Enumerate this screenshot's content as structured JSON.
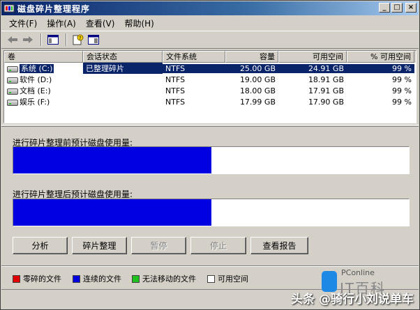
{
  "window": {
    "title": "磁盘碎片整理程序"
  },
  "menu": [
    "文件(F)",
    "操作(A)",
    "查看(V)",
    "帮助(H)"
  ],
  "list": {
    "columns": [
      "卷",
      "会话状态",
      "文件系统",
      "容量",
      "可用空间",
      "% 可用空间"
    ],
    "rows": [
      {
        "volume": "系统 (C:)",
        "status": "已整理碎片",
        "fs": "NTFS",
        "capacity": "25.00 GB",
        "free": "24.91 GB",
        "pct": "99 %",
        "selected": true
      },
      {
        "volume": "软件 (D:)",
        "status": "",
        "fs": "NTFS",
        "capacity": "19.00 GB",
        "free": "18.91 GB",
        "pct": "99 %"
      },
      {
        "volume": "文档 (E:)",
        "status": "",
        "fs": "NTFS",
        "capacity": "18.00 GB",
        "free": "17.91 GB",
        "pct": "99 %"
      },
      {
        "volume": "娱乐 (F:)",
        "status": "",
        "fs": "NTFS",
        "capacity": "17.99 GB",
        "free": "17.90 GB",
        "pct": "99 %"
      }
    ]
  },
  "before": {
    "label": "进行碎片整理前预计磁盘使用量:",
    "contiguous_fraction": 0.5
  },
  "after": {
    "label": "进行碎片整理后预计磁盘使用量:",
    "contiguous_fraction": 0.5
  },
  "buttons": {
    "analyze": "分析",
    "defrag": "碎片整理",
    "pause": "暂停",
    "stop": "停止",
    "report": "查看报告"
  },
  "legend": [
    {
      "label": "零碎的文件",
      "color": "#e00000"
    },
    {
      "label": "连续的文件",
      "color": "#0000e0"
    },
    {
      "label": "无法移动的文件",
      "color": "#20c020"
    },
    {
      "label": "可用空间",
      "color": "#ffffff"
    }
  ],
  "brand": {
    "top": "PConline",
    "name": "IT百科"
  },
  "watermark": "头条 @骑行小刘说单车"
}
